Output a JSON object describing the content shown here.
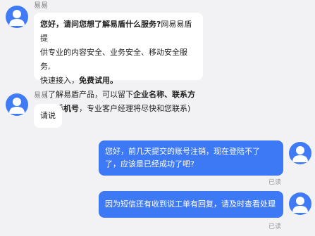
{
  "messages": [
    {
      "sender": "易易",
      "greeting_part1": "您好，",
      "greeting_part2": "请问您想了解易盾什么服务?",
      "greeting_part3": "网易易盾提",
      "line2": "供专业的内容安全、业务安全、移动安全服务,",
      "line3_part1": "快速接入，",
      "line3_part2": "免费试用。",
      "line4_part1": "（了解易盾产品，可以留下",
      "line4_part2": "企业名称、联系方",
      "line5_part1": "式、手机号",
      "line5_part2": "，专业客户经理将尽快和您联系)"
    },
    {
      "sender": "易易",
      "text": "请说"
    },
    {
      "line1": "您好，前几天提交的账号注销，现在登陆不了",
      "line2": "了，应该是已经成功了吧?",
      "status": "已读"
    },
    {
      "line1": "因为短信还有收到说工单有回复，请及时查看处理",
      "status": "已读"
    }
  ],
  "colors": {
    "background": "#f2f2f4",
    "outgoing_bubble": "#3e79f5",
    "incoming_bubble": "#ffffff",
    "avatar": "#3f7bf6"
  },
  "icons": {
    "avatar": "user-silhouette-icon"
  }
}
